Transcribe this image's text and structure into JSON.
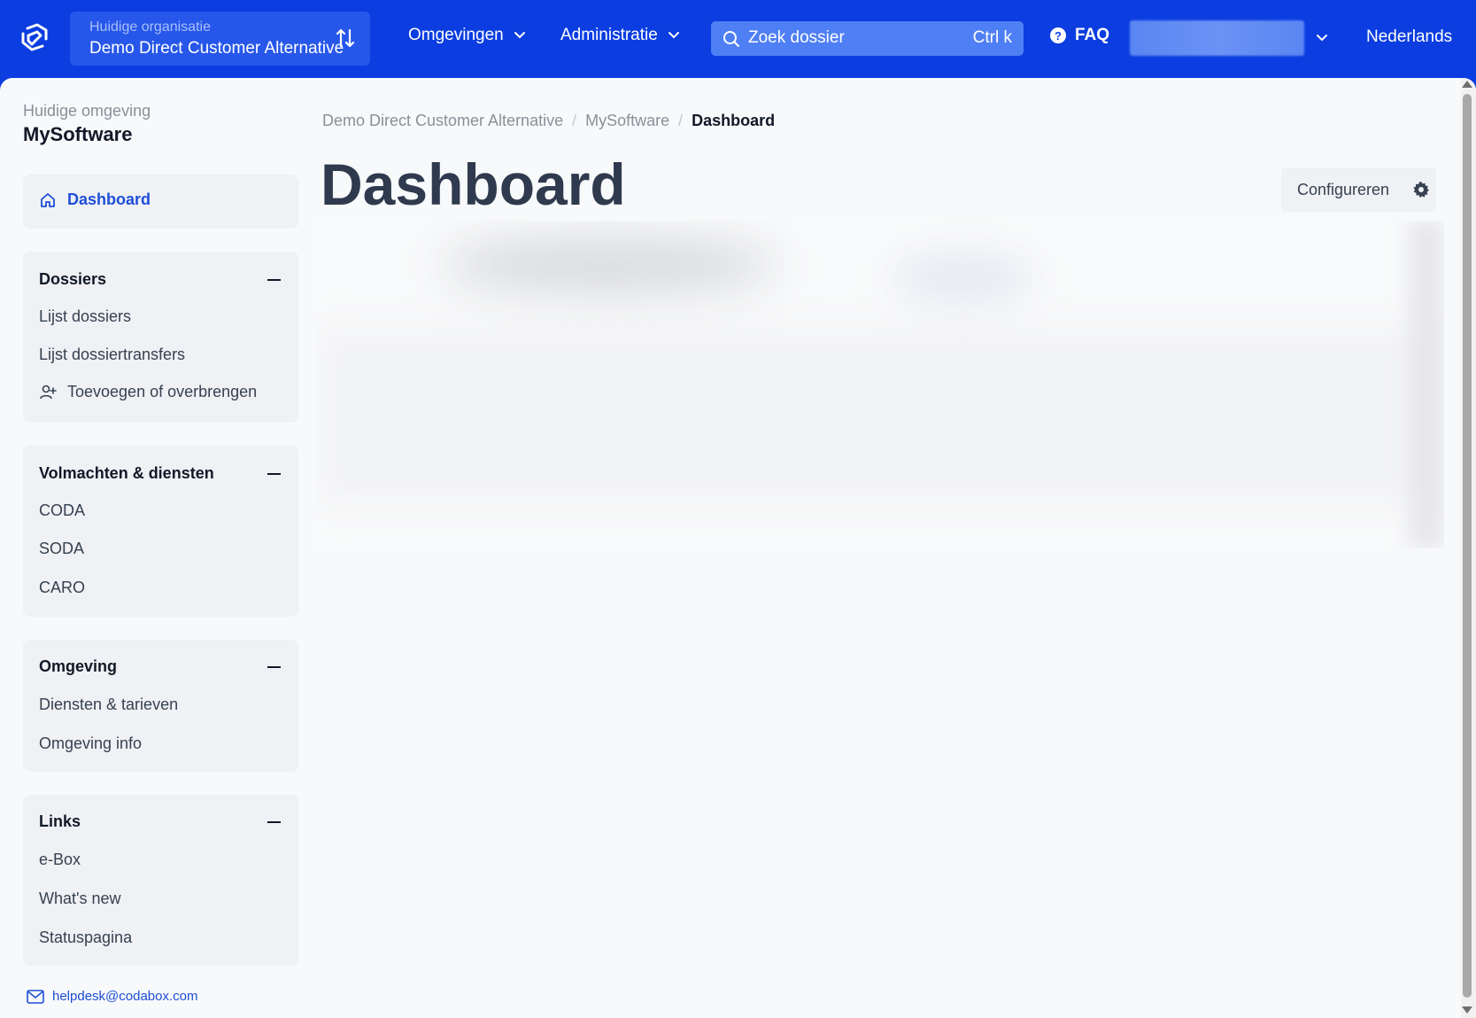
{
  "topbar": {
    "org_label": "Huidige organisatie",
    "org_value": "Demo Direct Customer Alternative",
    "nav_omgevingen": "Omgevingen",
    "nav_administratie": "Administratie",
    "search_placeholder": "Zoek dossier",
    "search_shortcut": "Ctrl k",
    "faq": "FAQ",
    "language": "Nederlands",
    "brand_color": "#0b3de0"
  },
  "sidebar": {
    "env_label": "Huidige omgeving",
    "env_value": "MySoftware",
    "dashboard": "Dashboard",
    "sections": {
      "dossiers": {
        "title": "Dossiers",
        "items": [
          "Lijst dossiers",
          "Lijst dossiertransfers",
          "Toevoegen of overbrengen"
        ]
      },
      "volmachten": {
        "title": "Volmachten & diensten",
        "items": [
          "CODA",
          "SODA",
          "CARO"
        ]
      },
      "omgeving": {
        "title": "Omgeving",
        "items": [
          "Diensten & tarieven",
          "Omgeving info"
        ]
      },
      "links": {
        "title": "Links",
        "items": [
          "e-Box",
          "What's new",
          "Statuspagina"
        ]
      }
    },
    "helpdesk": "helpdesk@codabox.com"
  },
  "content": {
    "breadcrumb": [
      "Demo Direct Customer Alternative",
      "MySoftware",
      "Dashboard"
    ],
    "title": "Dashboard",
    "configure": "Configureren"
  }
}
